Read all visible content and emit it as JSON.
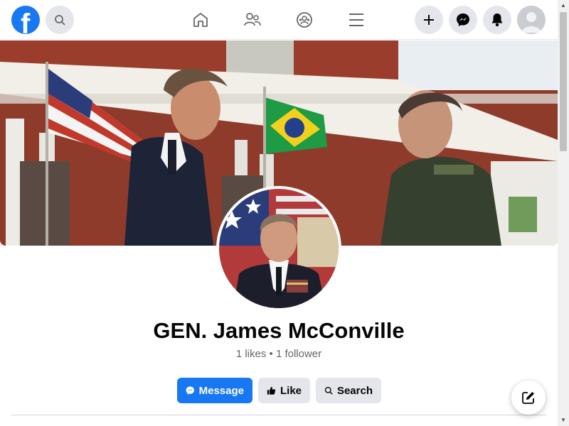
{
  "nav": {
    "logo_glyph": "f",
    "logo_icon": "facebook-logo-icon",
    "search_icon": "search-icon",
    "tabs": [
      {
        "name": "home-icon"
      },
      {
        "name": "friends-icon"
      },
      {
        "name": "groups-icon"
      },
      {
        "name": "menu-icon"
      }
    ],
    "right_buttons": [
      {
        "name": "plus-icon"
      },
      {
        "name": "messenger-icon"
      },
      {
        "name": "bell-icon"
      }
    ],
    "avatar_icon": "default-avatar-icon"
  },
  "profile": {
    "name": "GEN. James McConville",
    "stats": "1 likes • 1 follower"
  },
  "actions": {
    "message_label": "Message",
    "like_label": "Like",
    "search_label": "Search"
  },
  "colors": {
    "brand": "#1877f2",
    "secondary_bg": "#e4e6eb",
    "text_primary": "#050505",
    "text_secondary": "#65676b"
  },
  "fab_icon": "compose-icon"
}
